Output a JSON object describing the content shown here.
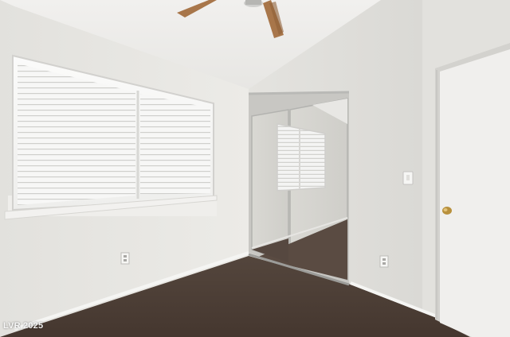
{
  "watermark": {
    "text": "LVR 2025"
  },
  "colors": {
    "ceiling": "#ecebe8",
    "wall_left": "#e6e5e1",
    "wall_right": "#dfdedb",
    "carpet": "#4a3c35",
    "mirror_frame": "#b9b9b6",
    "door": "#f0efed",
    "door_knob": "#b8903c",
    "fan_blade": "#a8764a"
  },
  "icons": [
    "ceiling-fan-icon",
    "door-knob-icon",
    "outlet-icon",
    "light-switch-icon"
  ]
}
